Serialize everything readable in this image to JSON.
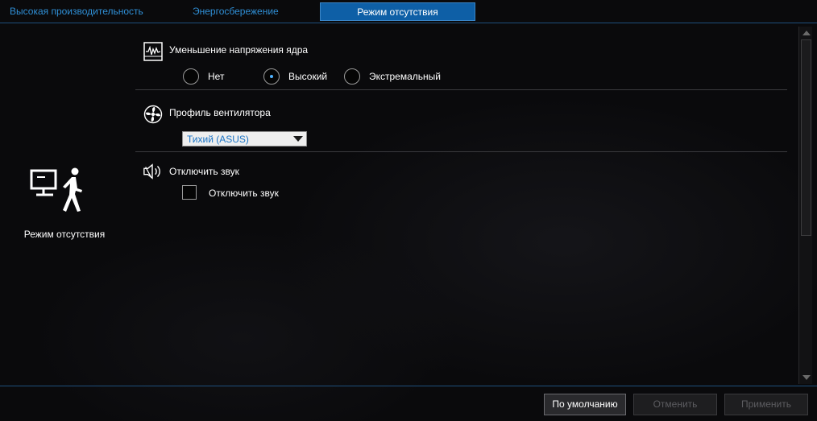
{
  "tabs": [
    {
      "label": "Высокая производительность"
    },
    {
      "label": "Энергосбережение"
    },
    {
      "label": "Режим отсутствия",
      "active": true
    }
  ],
  "left_panel": {
    "icon": "monitor-walking-person-icon",
    "label": "Режим отсутствия"
  },
  "core_voltage": {
    "title": "Уменьшение напряжения ядра",
    "icon": "waveform-monitor-icon",
    "options": [
      {
        "label": "Нет",
        "selected": false
      },
      {
        "label": "Высокий",
        "selected": true
      },
      {
        "label": "Экстремальный",
        "selected": false
      }
    ]
  },
  "fan_profile": {
    "title": "Профиль вентилятора",
    "icon": "fan-icon",
    "selected_value": "Тихий (ASUS)"
  },
  "mute": {
    "title": "Отключить звук",
    "icon": "speaker-mute-icon",
    "checkbox_label": "Отключить звук",
    "checked": false
  },
  "buttons": {
    "default_label": "По умолчанию",
    "cancel_label": "Отменить",
    "apply_label": "Применить"
  },
  "colors": {
    "accent": "#0e5fa6",
    "tab_text": "#2f8fd6",
    "radio_dot": "#4fb2ff"
  }
}
